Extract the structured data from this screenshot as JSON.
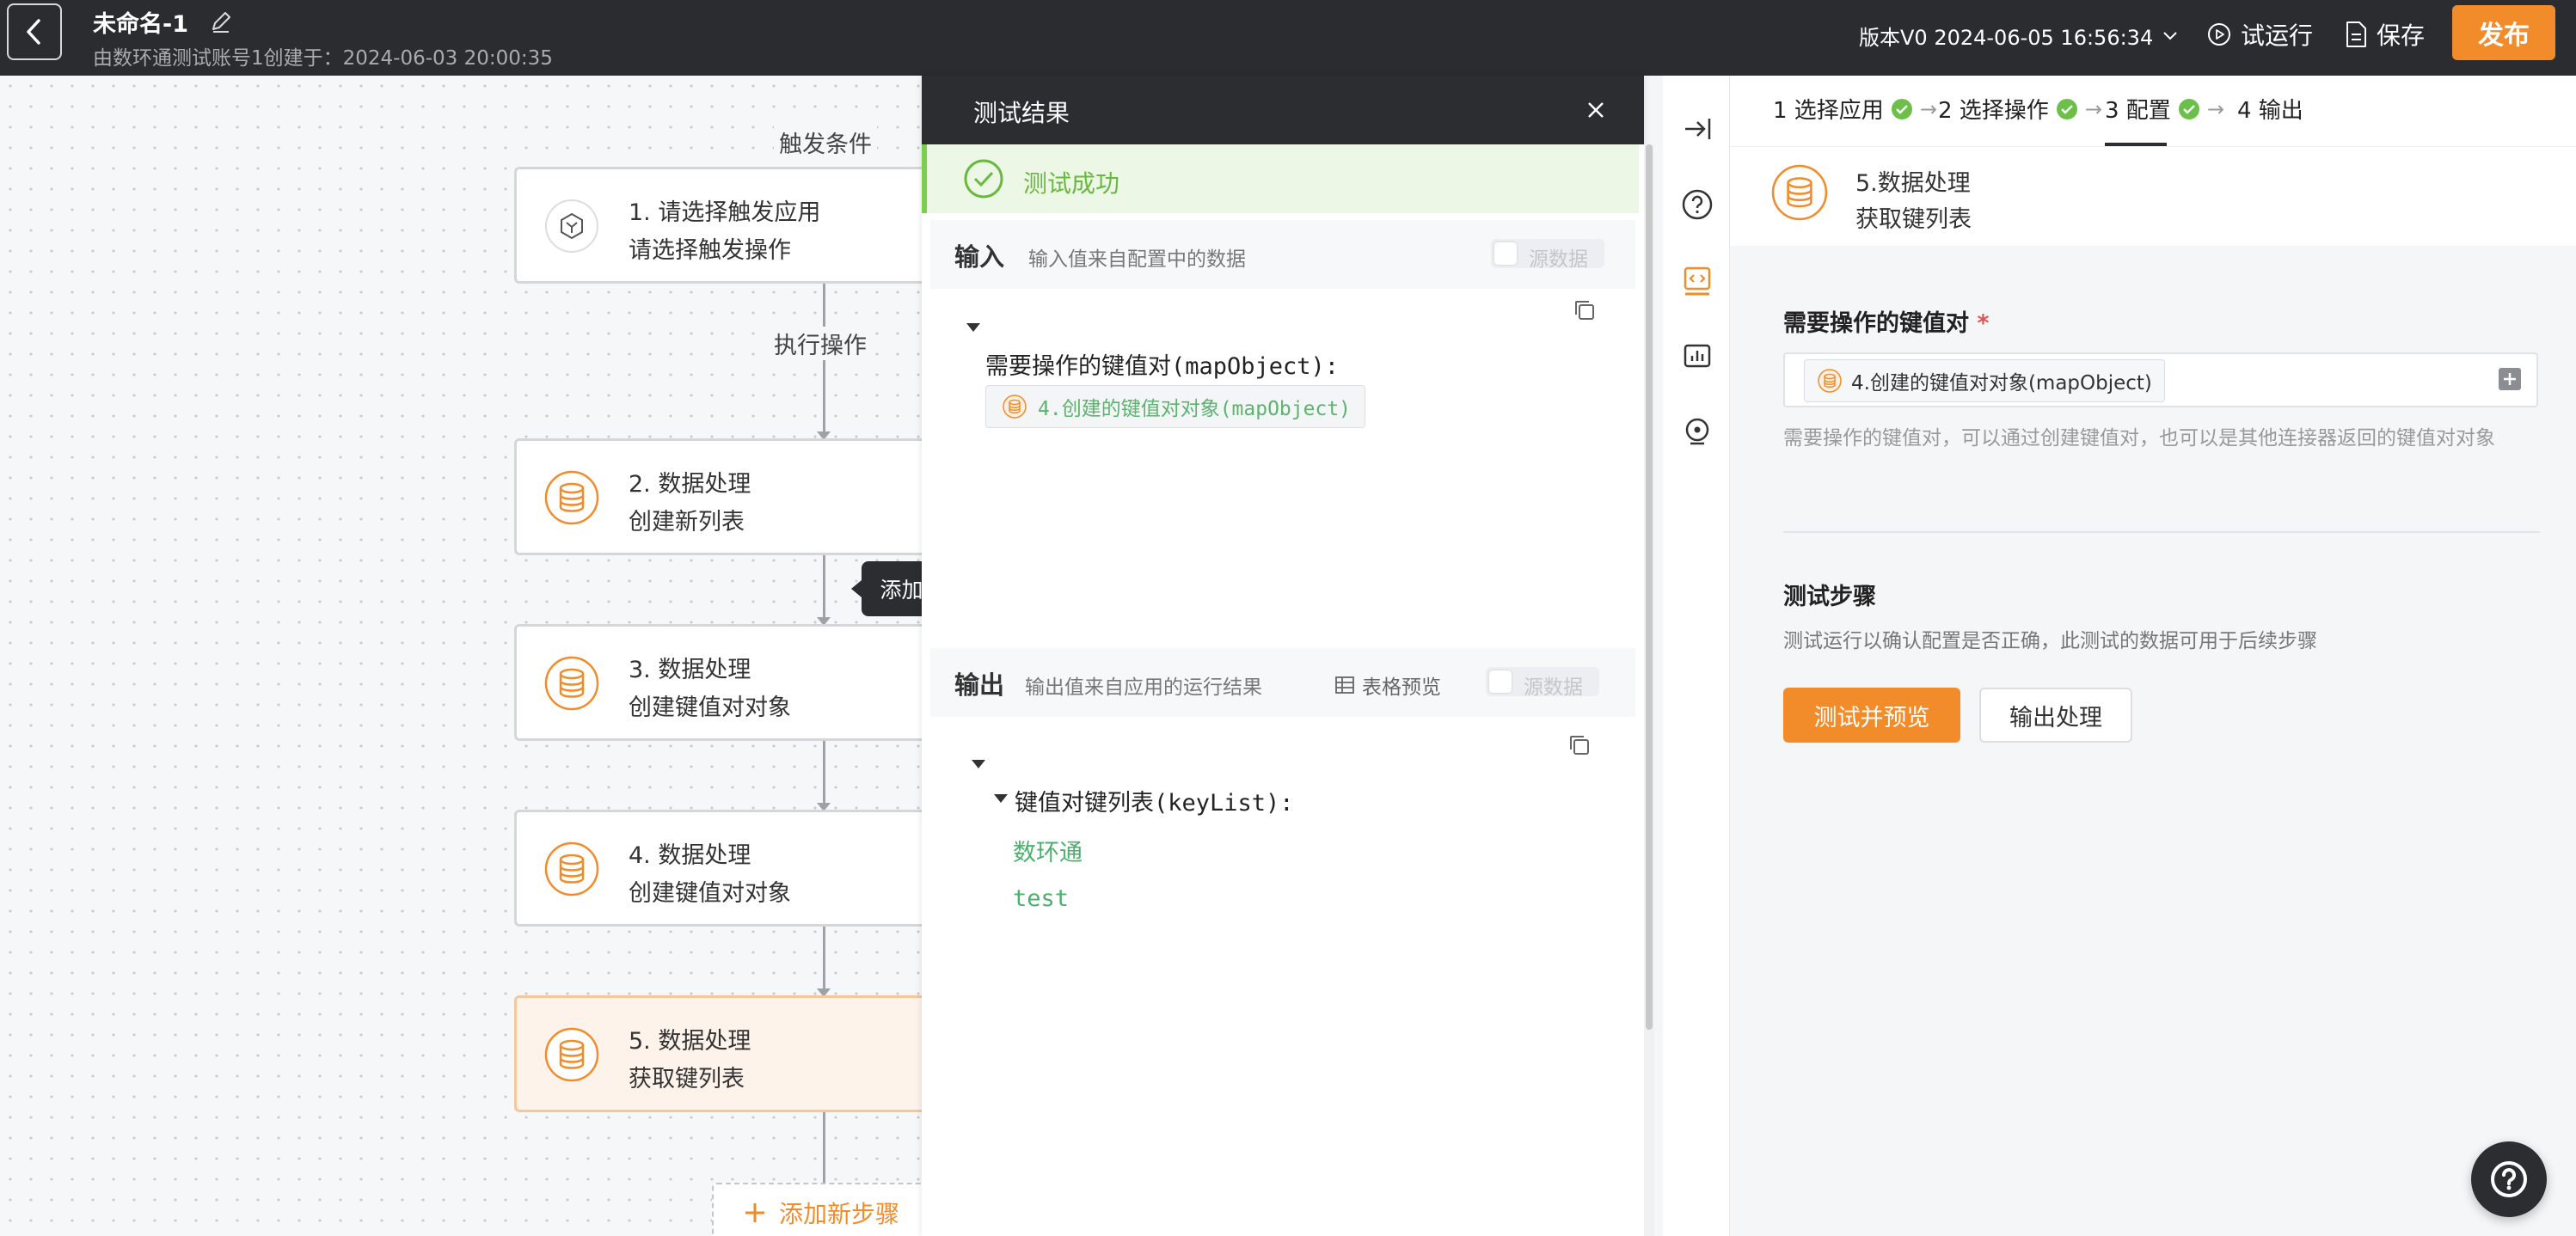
{
  "topbar": {
    "title": "未命名-1",
    "subtitle": "由数环通测试账号1创建于：2024-06-03 20:00:35",
    "version": "版本V0 2024-06-05 16:56:34",
    "trial_run": "试运行",
    "save": "保存",
    "publish": "发布"
  },
  "flow": {
    "trigger_label": "触发条件",
    "action_label": "执行操作",
    "nodes": [
      {
        "line1": "1. 请选择触发应用",
        "line2": "请选择触发操作"
      },
      {
        "line1": "2. 数据处理",
        "line2": "创建新列表"
      },
      {
        "line1": "3. 数据处理",
        "line2": "创建键值对对象"
      },
      {
        "line1": "4. 数据处理",
        "line2": "创建键值对对象"
      },
      {
        "line1": "5. 数据处理",
        "line2": "获取键列表"
      }
    ],
    "tooltip": "添加新步骤",
    "add_step": "添加新步骤"
  },
  "result": {
    "title": "测试结果",
    "success": "测试成功",
    "input": {
      "title": "输入",
      "desc": "输入值来自配置中的数据",
      "toggle": "源数据",
      "key": "需要操作的键值对(mapObject):",
      "ref": "4.创建的键值对对象(mapObject)"
    },
    "output": {
      "title": "输出",
      "desc": "输出值来自应用的运行结果",
      "table_preview": "表格预览",
      "toggle": "源数据",
      "key": "键值对键列表(keyList):",
      "values": [
        "数环通",
        "test"
      ]
    }
  },
  "config": {
    "steps": [
      {
        "label": "1 选择应用"
      },
      {
        "label": "2 选择操作"
      },
      {
        "label": "3 配置"
      },
      {
        "label": "4 输出"
      }
    ],
    "node": {
      "line1": "5.数据处理",
      "line2": "获取键列表"
    },
    "field": {
      "label": "需要操作的键值对",
      "required": "*",
      "chip": "4.创建的键值对对象(mapObject)",
      "help": "需要操作的键值对，可以通过创建键值对，也可以是其他连接器返回的键值对对象"
    },
    "test": {
      "title": "测试步骤",
      "desc": "测试运行以确认配置是否正确，此测试的数据可用于后续步骤",
      "primary": "测试并预览",
      "secondary": "输出处理"
    }
  },
  "colors": {
    "accent": "#f28c2a",
    "success": "#69b840",
    "dark": "#2c2d30"
  }
}
